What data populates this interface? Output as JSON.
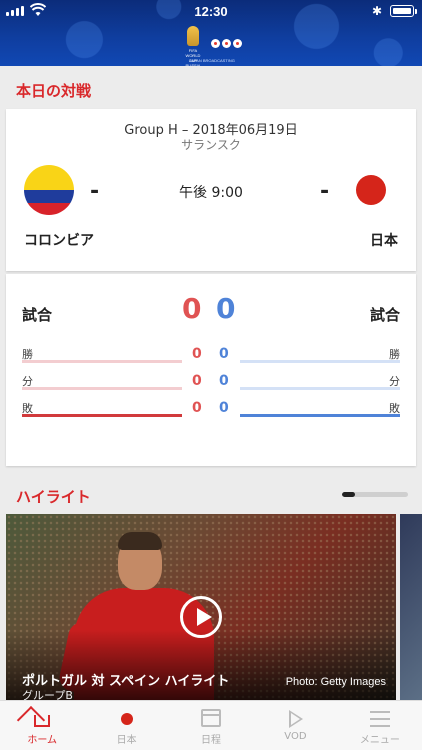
{
  "status_bar": {
    "time": "12:30"
  },
  "header": {
    "world_cup_logo_text": "FIFA WORLD CUP RUSSIA 2018",
    "broadcaster_logo": "NHK",
    "broadcaster_subtitle": "JAPAN BROADCASTING"
  },
  "today": {
    "title": "本日の対戦",
    "match": {
      "group_date": "Group H – 2018年06月19日",
      "venue": "サランスク",
      "kickoff": "午後 9:00",
      "home_team": "コロンビア",
      "away_team": "日本",
      "home_score_dash": "-",
      "away_score_dash": "-"
    },
    "record": {
      "games_label": "試合",
      "home_games": "0",
      "away_games": "0",
      "rows": [
        {
          "label": "勝",
          "home": "0",
          "away": "0"
        },
        {
          "label": "分",
          "home": "0",
          "away": "0"
        },
        {
          "label": "敗",
          "home": "0",
          "away": "0"
        }
      ]
    }
  },
  "highlights": {
    "title": "ハイライト",
    "carousel_position": 0.2,
    "video": {
      "title": "ポルトガル 対 スペイン ハイライト",
      "subtitle": "グループB",
      "credit": "Photo: Getty Images"
    }
  },
  "tabbar": {
    "tabs": [
      {
        "label": "ホーム",
        "icon": "home-icon",
        "active": true
      },
      {
        "label": "日本",
        "icon": "japan-flag-icon",
        "active": false
      },
      {
        "label": "日程",
        "icon": "calendar-icon",
        "active": false
      },
      {
        "label": "VOD",
        "icon": "play-icon",
        "active": false
      },
      {
        "label": "メニュー",
        "icon": "menu-icon",
        "active": false
      }
    ]
  },
  "colors": {
    "accent": "#d9282b",
    "home_team": "#e05353",
    "away_team": "#4f83d8",
    "header_bg": "#0f3d9e"
  }
}
